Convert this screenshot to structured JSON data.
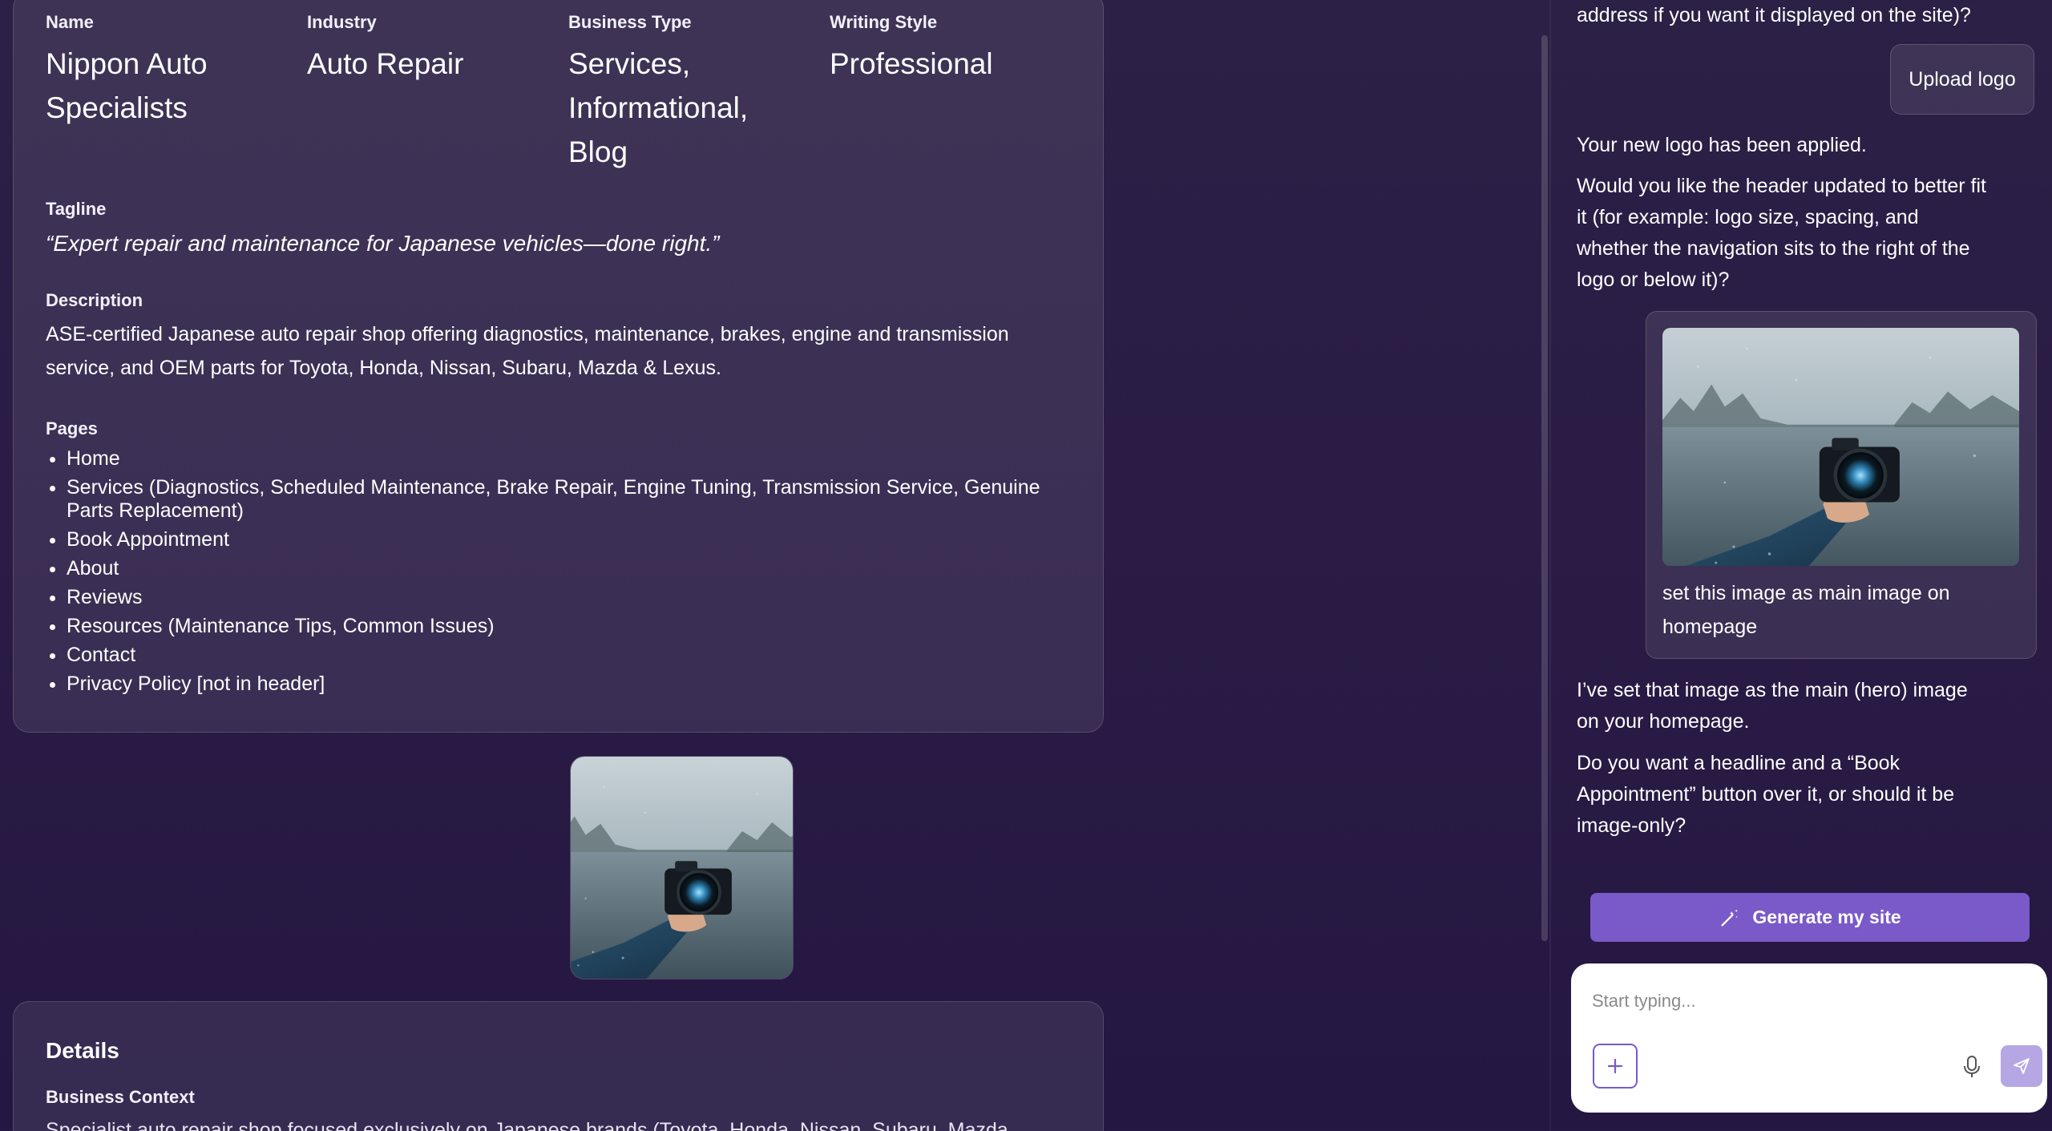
{
  "summary": {
    "name_label": "Name",
    "name_value": "Nippon Auto Specialists",
    "industry_label": "Industry",
    "industry_value": "Auto Repair",
    "business_type_label": "Business Type",
    "business_type_value": "Services, Informational, Blog",
    "writing_style_label": "Writing Style",
    "writing_style_value": "Professional",
    "tagline_label": "Tagline",
    "tagline_value": "“Expert repair and maintenance for Japanese vehicles—done right.”",
    "description_label": "Description",
    "description_value": "ASE-certified Japanese auto repair shop offering diagnostics, maintenance, brakes, engine and transmission service, and OEM parts for Toyota, Honda, Nissan, Subaru, Mazda & Lexus.",
    "pages_label": "Pages",
    "pages": [
      "Home",
      "Services (Diagnostics, Scheduled Maintenance, Brake Repair, Engine Tuning, Transmission Service, Genuine Parts Replacement)",
      "Book Appointment",
      "About",
      "Reviews",
      "Resources (Maintenance Tips, Common Issues)",
      "Contact",
      "Privacy Policy [not in header]"
    ]
  },
  "details": {
    "title": "Details",
    "business_context_label": "Business Context",
    "business_context_value": "Specialist auto repair shop focused exclusively on Japanese brands (Toyota, Honda, Nissan, Subaru, Mazda"
  },
  "chat": {
    "msg_top": "address if you want it displayed on the site)?",
    "user_upload": "Upload logo",
    "msg_logo_applied": "Your new logo has been applied.",
    "msg_header_question": "Would you like the header updated to better fit it (for example: logo size, spacing, and whether the navigation sits to the right of the logo or below it)?",
    "user_image_caption": "set this image as main image on homepage",
    "msg_hero_set": "I’ve set that image as the main (hero) image on your homepage.",
    "msg_headline_question": "Do you want a headline and a “Book Appointment” button over it, or should it be image-only?",
    "generate_label": "Generate my site",
    "input_placeholder": "Start typing..."
  },
  "colors": {
    "accent": "#7a59c9",
    "send_disabled": "#b6a6e4",
    "background": "#2a1c45"
  },
  "icons": [
    "magic-wand-icon",
    "plus-icon",
    "microphone-icon",
    "send-icon"
  ]
}
